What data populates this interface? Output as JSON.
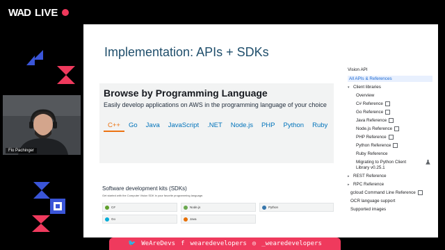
{
  "brand": {
    "logo": "WAD",
    "live": "LIVE"
  },
  "presenter": {
    "name": "Flo Pachinger"
  },
  "slide": {
    "title": "Implementation: APIs + SDKs",
    "aws": {
      "heading": "Browse by Programming Language",
      "subheading": "Easily develop applications on AWS in the programming language of your choice",
      "tabs": [
        "C++",
        "Go",
        "Java",
        "JavaScript",
        ".NET",
        "Node.js",
        "PHP",
        "Python",
        "Ruby"
      ],
      "active_tab": "C++"
    },
    "sdk": {
      "heading": "Software development kits (SDKs)",
      "description": "Get started with the Computer Vision SDK in your favorite programming language.",
      "cards": [
        {
          "label": "C#",
          "color": "#5fa02c"
        },
        {
          "label": "Node.js",
          "color": "#6aa84f"
        },
        {
          "label": "Python",
          "color": "#3776ab"
        },
        {
          "label": "Go",
          "color": "#00add8"
        },
        {
          "label": "Java",
          "color": "#e76f00"
        }
      ]
    },
    "nav": {
      "title": "Vision API",
      "selected": "All APIs & References",
      "client_libraries": "Client libraries",
      "overview": "Overview",
      "references": [
        "C# Reference",
        "Go Reference",
        "Java Reference",
        "Node.js Reference",
        "PHP Reference",
        "Python Reference",
        "Ruby Reference"
      ],
      "migrating_line1": "Migrating to Python Client",
      "migrating_line2": "Library v0.25.1",
      "rest": "REST Reference",
      "rpc": "RPC Reference",
      "gcloud": "gcloud Command Line Reference",
      "ocr": "OCR language support",
      "images": "Supported images"
    }
  },
  "social": {
    "twitter": "WeAreDevs",
    "facebook": "wearedevelopers",
    "instagram": "_wearedevelopers"
  },
  "colors": {
    "accent": "#ef3a5d",
    "blue": "#3a55d8",
    "aws_orange": "#ec7211"
  }
}
